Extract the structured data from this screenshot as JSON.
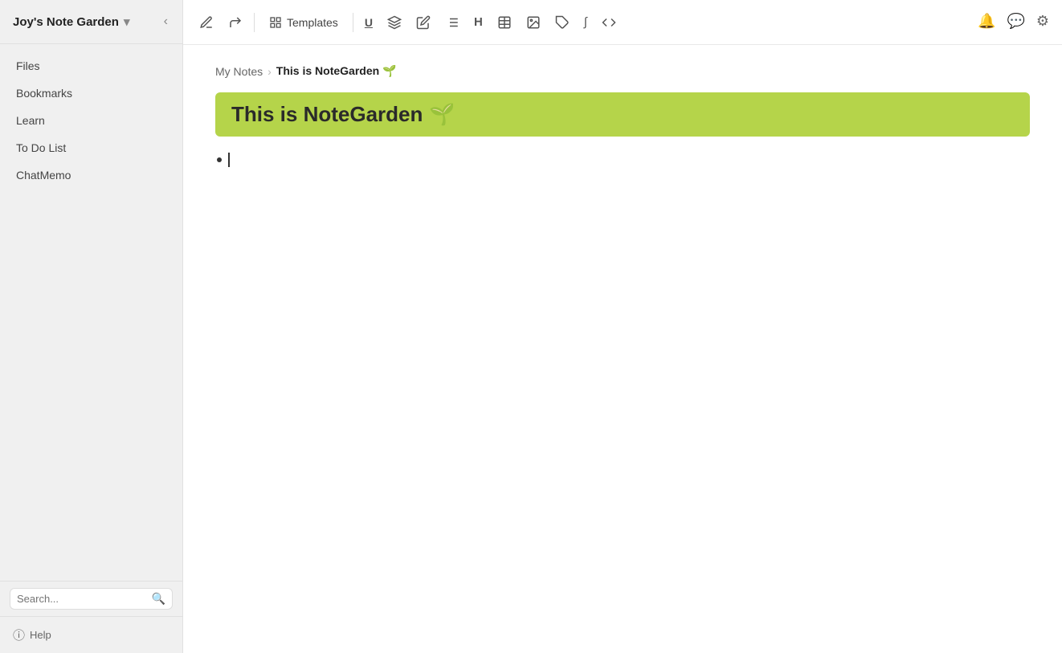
{
  "workspace": {
    "title": "Joy's Note Garden",
    "dropdown_icon": "▾"
  },
  "sidebar": {
    "nav_items": [
      {
        "id": "files",
        "label": "Files"
      },
      {
        "id": "bookmarks",
        "label": "Bookmarks"
      },
      {
        "id": "learn",
        "label": "Learn"
      },
      {
        "id": "todo",
        "label": "To Do List"
      },
      {
        "id": "chatmemo",
        "label": "ChatMemo"
      }
    ],
    "search_placeholder": "Search...",
    "help_label": "Help"
  },
  "toolbar": {
    "templates_label": "Templates",
    "buttons": [
      {
        "id": "pen",
        "icon": "✏️",
        "label": "pen-tool"
      },
      {
        "id": "redo",
        "icon": "⤻",
        "label": "redo-tool"
      },
      {
        "id": "underline",
        "icon": "U",
        "label": "underline-tool"
      },
      {
        "id": "highlight",
        "icon": "▮",
        "label": "highlight-tool"
      },
      {
        "id": "edit",
        "icon": "✎",
        "label": "edit-tool"
      },
      {
        "id": "list",
        "icon": "☰",
        "label": "list-tool"
      },
      {
        "id": "heading",
        "icon": "H",
        "label": "heading-tool"
      },
      {
        "id": "table",
        "icon": "⊞",
        "label": "table-tool"
      },
      {
        "id": "image",
        "icon": "🖼",
        "label": "image-tool"
      },
      {
        "id": "tag",
        "icon": "🏷",
        "label": "tag-tool"
      },
      {
        "id": "formula",
        "icon": "∫",
        "label": "formula-tool"
      },
      {
        "id": "code",
        "icon": "</>",
        "label": "code-tool"
      }
    ]
  },
  "top_icons": {
    "notification": "🔔",
    "chat": "💬",
    "settings": "⚙"
  },
  "breadcrumb": {
    "parent": "My Notes",
    "separator": "›",
    "current": "This is NoteGarden 🌱"
  },
  "note": {
    "title": "This is NoteGarden",
    "title_emoji": "🌱",
    "title_bg_color": "#b5d44a"
  },
  "colors": {
    "sidebar_bg": "#f0f0f0",
    "toolbar_bg": "#ffffff",
    "note_title_bg": "#b5d44a",
    "text_primary": "#222222",
    "text_secondary": "#666666"
  }
}
